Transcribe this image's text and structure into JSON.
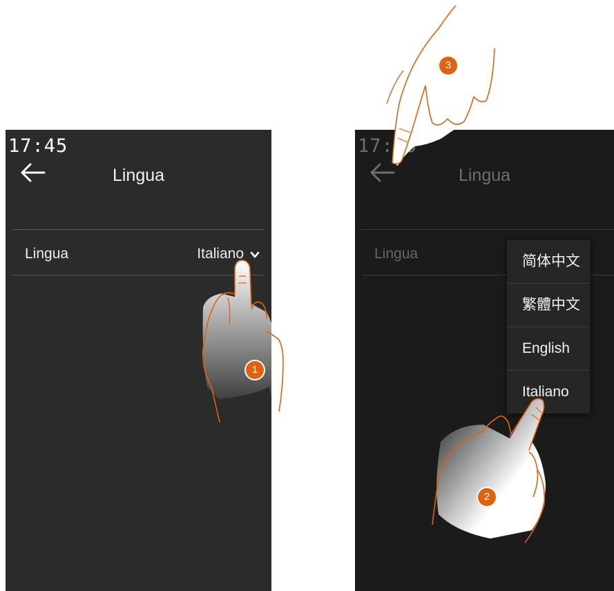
{
  "screens": [
    {
      "clock": "17:45",
      "title": "Lingua",
      "setting_label": "Lingua",
      "setting_value": "Italiano"
    },
    {
      "clock": "17:45",
      "title": "Lingua",
      "setting_label": "Lingua",
      "dropdown_options": [
        "简体中文",
        "繁體中文",
        "English",
        "Italiano"
      ]
    }
  ],
  "steps": [
    "1",
    "2",
    "3"
  ],
  "icons": {
    "back": "arrow-left-icon",
    "dropdown": "chevron-down-icon",
    "hand": "pointing-hand-icon"
  },
  "colors": {
    "accent": "#e0620f",
    "screen_bg": "#2b2b2b",
    "screen_bg_dimmed": "#1b1b1b",
    "text": "#eeeeee"
  }
}
